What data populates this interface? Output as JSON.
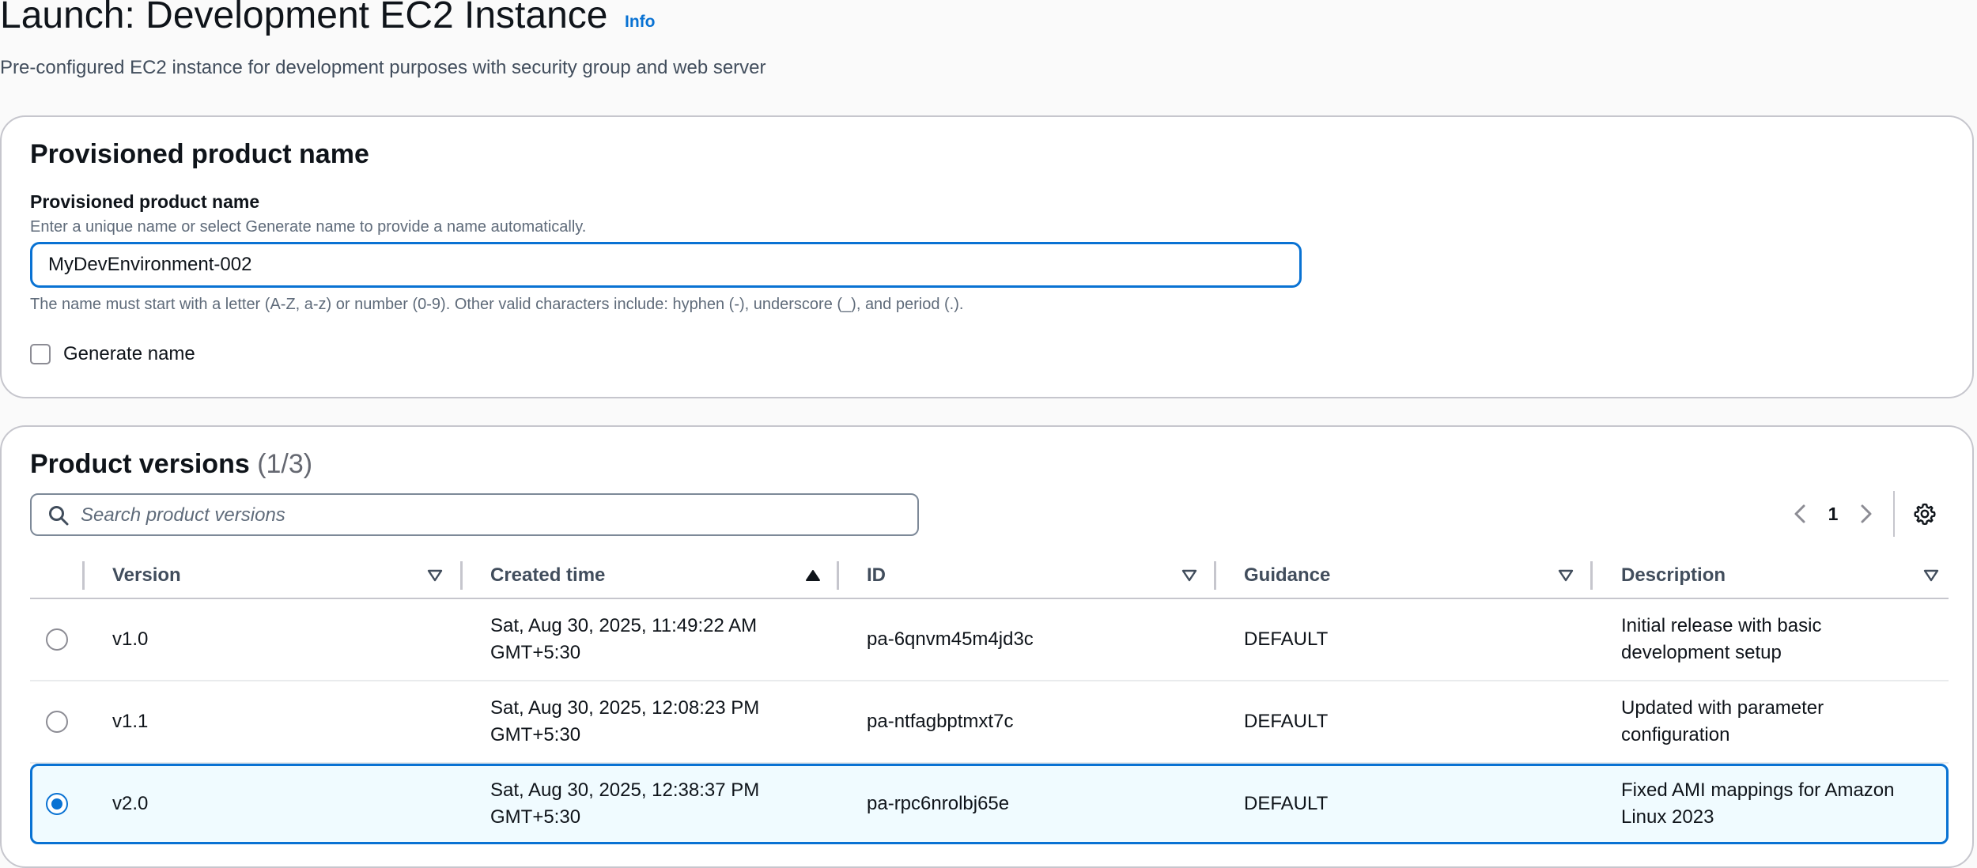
{
  "header": {
    "title": "Launch: Development EC2 Instance",
    "info_label": "Info",
    "subtitle": "Pre-configured EC2 instance for development purposes with security group and web server"
  },
  "name_panel": {
    "title": "Provisioned product name",
    "field_label": "Provisioned product name",
    "field_description": "Enter a unique name or select Generate name to provide a name automatically.",
    "input_value": "MyDevEnvironment-002",
    "constraint_text": "The name must start with a letter (A-Z, a-z) or number (0-9). Other valid characters include: hyphen (-), underscore (_), and period (.).",
    "generate_name_label": "Generate name",
    "generate_name_checked": false
  },
  "versions_panel": {
    "title": "Product versions",
    "count": "(1/3)",
    "search_placeholder": "Search product versions",
    "page_number": "1",
    "columns": {
      "version": "Version",
      "created_time": "Created time",
      "id": "ID",
      "guidance": "Guidance",
      "description": "Description"
    },
    "sort_column": "created_time",
    "rows": [
      {
        "version": "v1.0",
        "created_line1": "Sat, Aug 30, 2025, 11:49:22 AM",
        "created_line2": "GMT+5:30",
        "id": "pa-6qnvm45m4jd3c",
        "guidance": "DEFAULT",
        "description_line1": "Initial release with basic",
        "description_line2": "development setup",
        "selected": false
      },
      {
        "version": "v1.1",
        "created_line1": "Sat, Aug 30, 2025, 12:08:23 PM",
        "created_line2": "GMT+5:30",
        "id": "pa-ntfagbptmxt7c",
        "guidance": "DEFAULT",
        "description_line1": "Updated with parameter",
        "description_line2": "configuration",
        "selected": false
      },
      {
        "version": "v2.0",
        "created_line1": "Sat, Aug 30, 2025, 12:38:37 PM",
        "created_line2": "GMT+5:30",
        "id": "pa-rpc6nrolbj65e",
        "guidance": "DEFAULT",
        "description_line1": "Fixed AMI mappings for Amazon",
        "description_line2": "Linux 2023",
        "selected": true
      }
    ]
  },
  "colors": {
    "accent": "#0972d3",
    "border": "#c6c6cd",
    "selected_row_bg": "#f0fbff"
  },
  "icons": {
    "search": "search-icon",
    "sort_desc": "caret-down-outline-icon",
    "sort_asc": "caret-up-filled-icon",
    "prev_page": "chevron-left-icon",
    "next_page": "chevron-right-icon",
    "settings": "gear-icon"
  }
}
